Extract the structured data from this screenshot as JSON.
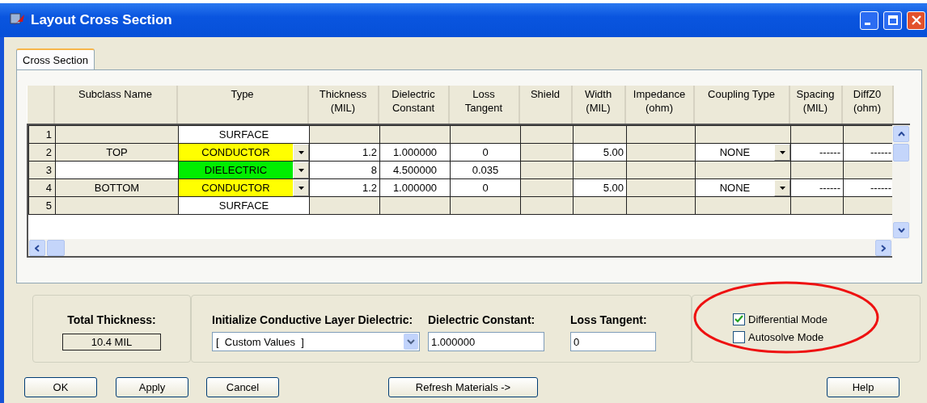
{
  "window": {
    "title": "Layout Cross Section"
  },
  "tabs": [
    {
      "label": "Cross Section",
      "selected": true
    }
  ],
  "table": {
    "columns": [
      "Subclass Name",
      "Type",
      "Thickness\n(MIL)",
      "Dielectric\nConstant",
      "Loss\nTangent",
      "Shield",
      "Width\n(MIL)",
      "Impedance\n(ohm)",
      "Coupling Type",
      "Spacing\n(MIL)",
      "DiffZ0\n(ohm)"
    ],
    "rows": [
      {
        "number": "1",
        "kind": "surface",
        "color": "#ffffff",
        "cells": [
          null,
          "SURFACE",
          null,
          null,
          null,
          null,
          null,
          null,
          null,
          null,
          null
        ]
      },
      {
        "number": "2",
        "kind": "conductor",
        "color": "#ffff00",
        "cells": [
          "TOP",
          "CONDUCTOR",
          "1.2",
          "1.000000",
          "0",
          null,
          "5.00",
          null,
          "NONE",
          "------",
          "------"
        ]
      },
      {
        "number": "3",
        "kind": "dielectric",
        "color": "#00ee00",
        "cells": [
          null,
          "DIELECTRIC",
          "8",
          "4.500000",
          "0.035",
          null,
          null,
          null,
          null,
          null,
          null
        ]
      },
      {
        "number": "4",
        "kind": "conductor",
        "color": "#ffff00",
        "cells": [
          "BOTTOM",
          "CONDUCTOR",
          "1.2",
          "1.000000",
          "0",
          null,
          "5.00",
          null,
          "NONE",
          "------",
          "------"
        ]
      },
      {
        "number": "5",
        "kind": "surface",
        "color": "#ffffff",
        "cells": [
          null,
          "SURFACE",
          null,
          null,
          null,
          null,
          null,
          null,
          null,
          null,
          null
        ]
      }
    ]
  },
  "total_thickness": {
    "label": "Total Thickness:",
    "value": "10.4 MIL"
  },
  "initialize": {
    "label": "Initialize Conductive Layer Dielectric:",
    "value": "[  Custom Values  ]"
  },
  "dielectric_constant": {
    "label": "Dielectric Constant:",
    "value": "1.000000"
  },
  "loss_tangent": {
    "label": "Loss Tangent:",
    "value": "0"
  },
  "options": [
    {
      "label": "Differential Mode",
      "checked": true
    },
    {
      "label": "Autosolve Mode",
      "checked": false
    }
  ],
  "buttons": [
    "OK",
    "Apply",
    "Cancel",
    "Refresh Materials ->",
    "Help"
  ]
}
